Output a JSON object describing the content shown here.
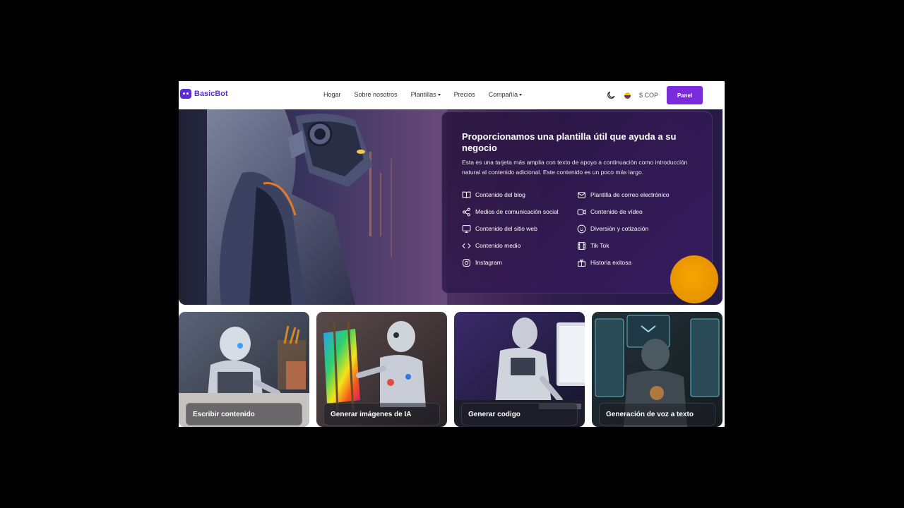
{
  "brand": {
    "name": "BasicBot"
  },
  "nav": {
    "items": [
      {
        "label": "Hogar"
      },
      {
        "label": "Sobre nosotros"
      },
      {
        "label": "Plantillas"
      },
      {
        "label": "Precios"
      },
      {
        "label": "Compañía"
      }
    ]
  },
  "header": {
    "currency": "$ COP",
    "panel_label": "Panel"
  },
  "hero": {
    "title": "Proporcionamos una plantilla útil que ayuda a su negocio",
    "description": "Esta es una tarjeta más amplia con texto de apoyo a continuación como introducción natural al contenido adicional. Este contenido es un poco más largo.",
    "features": [
      {
        "label": "Contenido del blog",
        "icon": "book-icon"
      },
      {
        "label": "Plantilla de correo electrónico",
        "icon": "mail-icon"
      },
      {
        "label": "Medios de comunicación social",
        "icon": "share-icon"
      },
      {
        "label": "Contenido de vídeo",
        "icon": "video-icon"
      },
      {
        "label": "Contenido del sitio web",
        "icon": "monitor-icon"
      },
      {
        "label": "Diversión y cotización",
        "icon": "smile-icon"
      },
      {
        "label": "Contenido medio",
        "icon": "code-icon"
      },
      {
        "label": "Tik Tok",
        "icon": "film-icon"
      },
      {
        "label": "Instagram",
        "icon": "instagram-icon"
      },
      {
        "label": "Historia exitosa",
        "icon": "gift-icon"
      }
    ]
  },
  "cards": [
    {
      "label": "Escribir contenido"
    },
    {
      "label": "Generar imágenes de IA"
    },
    {
      "label": "Generar codigo"
    },
    {
      "label": "Generación de voz a texto"
    }
  ],
  "colors": {
    "accent": "#7a2bdc",
    "brand": "#5b2bd8",
    "orb": "#f6a600"
  }
}
